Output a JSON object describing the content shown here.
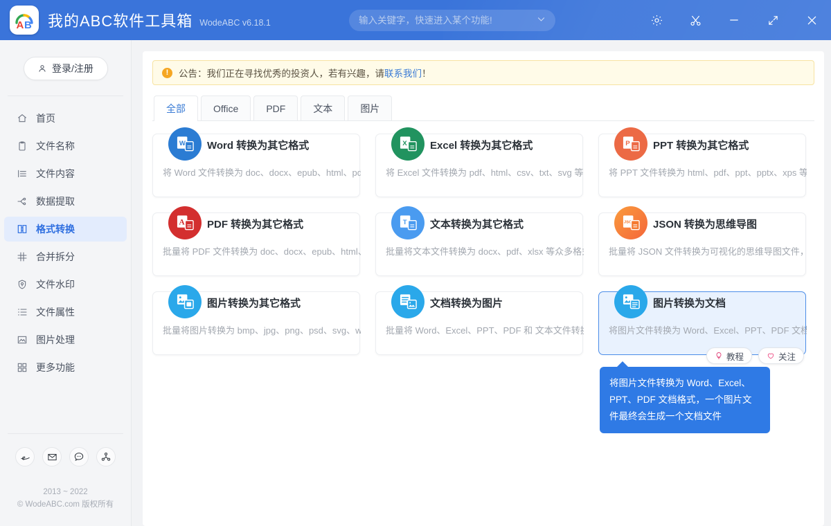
{
  "header": {
    "title": "我的ABC软件工具箱",
    "version": "WodeABC v6.18.1",
    "logo_text": "AB",
    "search": {
      "placeholder": "输入关键字，快速进入某个功能!",
      "value": ""
    },
    "window_buttons": [
      {
        "name": "settings",
        "label": "设置"
      },
      {
        "name": "scissors",
        "label": "截图"
      },
      {
        "name": "minimize",
        "label": "最小化"
      },
      {
        "name": "maximize",
        "label": "最大化"
      },
      {
        "name": "close",
        "label": "关闭"
      }
    ]
  },
  "sidebar": {
    "login_label": "登录/注册",
    "items": [
      {
        "label": "首页",
        "icon": "home-icon",
        "active": false
      },
      {
        "label": "文件名称",
        "icon": "file-name-icon",
        "active": false
      },
      {
        "label": "文件内容",
        "icon": "file-content-icon",
        "active": false
      },
      {
        "label": "数据提取",
        "icon": "data-extract-icon",
        "active": false
      },
      {
        "label": "格式转换",
        "icon": "format-convert-icon",
        "active": true
      },
      {
        "label": "合并拆分",
        "icon": "merge-split-icon",
        "active": false
      },
      {
        "label": "文件水印",
        "icon": "watermark-icon",
        "active": false
      },
      {
        "label": "文件属性",
        "icon": "file-property-icon",
        "active": false
      },
      {
        "label": "图片处理",
        "icon": "image-process-icon",
        "active": false
      },
      {
        "label": "更多功能",
        "icon": "more-features-icon",
        "active": false
      }
    ],
    "social": [
      {
        "name": "browser-icon",
        "label": "e"
      },
      {
        "name": "mail-icon",
        "label": "邮件"
      },
      {
        "name": "chat-icon",
        "label": "反馈"
      },
      {
        "name": "share-icon",
        "label": "分享"
      }
    ],
    "copyright_line1": "2013 ~ 2022",
    "copyright_line2": "© WodeABC.com 版权所有"
  },
  "notice": {
    "text_before": "公告：我们正在寻找优秀的投资人，若有兴趣，请",
    "link": "联系我们",
    "text_after": "！"
  },
  "tabs": [
    {
      "label": "全部",
      "active": true
    },
    {
      "label": "Office",
      "active": false
    },
    {
      "label": "PDF",
      "active": false
    },
    {
      "label": "文本",
      "active": false
    },
    {
      "label": "图片",
      "active": false
    }
  ],
  "cards": [
    {
      "title": "Word 转换为其它格式",
      "desc": "将 Word 文件转换为 doc、docx、epub、html、pd",
      "icon": "word-convert-icon",
      "icon_letter": "W",
      "color": "#2b7cd3",
      "selected": false
    },
    {
      "title": "Excel 转换为其它格式",
      "desc": "将 Excel 文件转换为 pdf、html、csv、txt、svg 等众",
      "icon": "excel-convert-icon",
      "icon_letter": "X",
      "color": "#21935f",
      "selected": false
    },
    {
      "title": "PPT 转换为其它格式",
      "desc": "将 PPT 文件转换为 html、pdf、ppt、pptx、xps 等众",
      "icon": "ppt-convert-icon",
      "icon_letter": "P",
      "color": "#ec6a45",
      "selected": false
    },
    {
      "title": "PDF 转换为其它格式",
      "desc": "批量将 PDF 文件转换为 doc、docx、epub、html、",
      "icon": "pdf-convert-icon",
      "icon_letter": "A",
      "color": "#d32f2f",
      "selected": false
    },
    {
      "title": "文本转换为其它格式",
      "desc": "批量将文本文件转换为 docx、pdf、xlsx 等众多格式",
      "icon": "text-convert-icon",
      "icon_letter": "T",
      "color": "#4a9bf0",
      "selected": false
    },
    {
      "title": "JSON 转换为思维导图",
      "desc": "批量将 JSON 文件转换为可视化的思维导图文件，在",
      "icon": "json-convert-icon",
      "icon_letter": "JSON",
      "color": "#f57a30",
      "selected": false
    },
    {
      "title": "图片转换为其它格式",
      "desc": "批量将图片转换为 bmp、jpg、png、psd、svg、w",
      "icon": "image-convert-icon",
      "icon_letter": "IMG",
      "color": "#2aa8ea",
      "selected": false
    },
    {
      "title": "文档转换为图片",
      "desc": "批量将 Word、Excel、PPT、PDF 和 文本文件转换为",
      "icon": "doc-to-image-icon",
      "icon_letter": "DOC",
      "color": "#2aa8ea",
      "selected": false
    },
    {
      "title": "图片转换为文档",
      "desc": "将图片文件转换为 Word、Excel、PPT、PDF 文档格",
      "icon": "image-to-doc-icon",
      "icon_letter": "IMG",
      "color": "#2aa8ea",
      "selected": true
    }
  ],
  "card_actions": {
    "tutorial_label": "教程",
    "follow_label": "关注"
  },
  "tooltip": {
    "text": "将图片文件转换为 Word、Excel、PPT、PDF 文档格式，一个图片文件最终会生成一个文档文件"
  }
}
